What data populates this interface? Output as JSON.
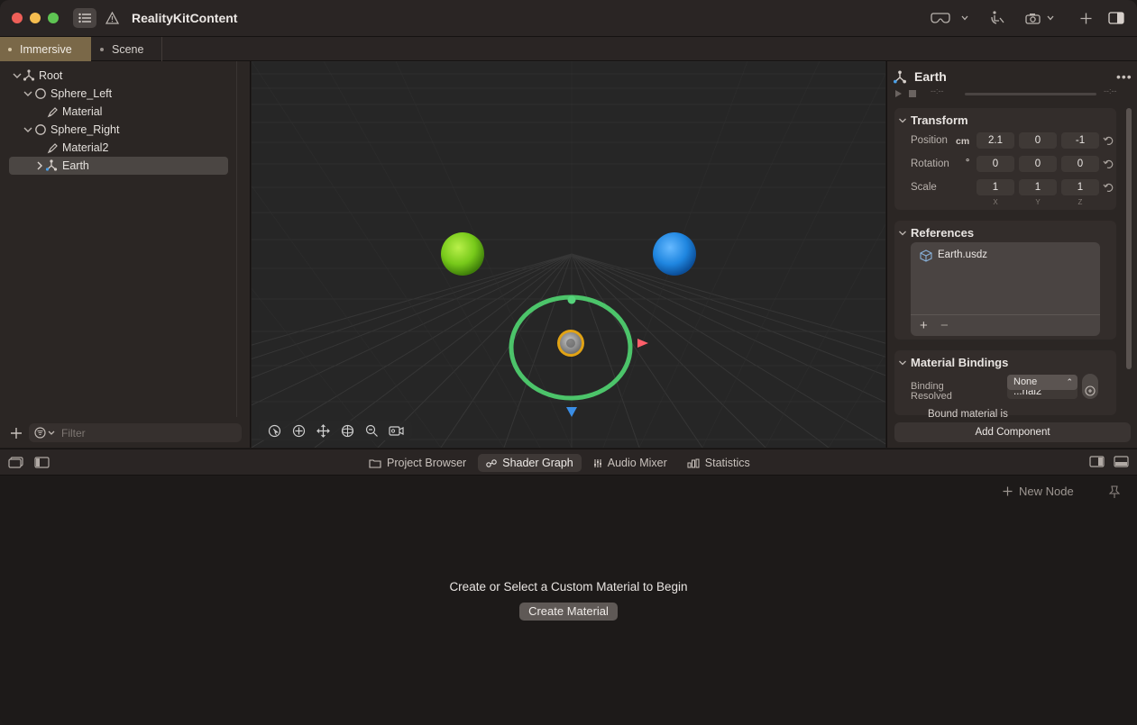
{
  "app": {
    "title": "RealityKitContent"
  },
  "tabs": [
    {
      "label": "Immersive",
      "active": true
    },
    {
      "label": "Scene",
      "active": false
    }
  ],
  "hierarchy": {
    "items": [
      {
        "label": "Root",
        "icon": "entity-icon",
        "expanded": true
      },
      {
        "label": "Sphere_Left",
        "icon": "sphere-icon",
        "expanded": true
      },
      {
        "label": "Material",
        "icon": "material-icon"
      },
      {
        "label": "Sphere_Right",
        "icon": "sphere-icon",
        "expanded": true
      },
      {
        "label": "Material2",
        "icon": "material-icon"
      },
      {
        "label": "Earth",
        "icon": "entity-icon",
        "expanded": false,
        "selected": true
      }
    ],
    "filter_placeholder": "Filter"
  },
  "inspector": {
    "title": "Earth",
    "timeline": {
      "start": "--:--",
      "end": "--:--"
    },
    "transform": {
      "header": "Transform",
      "position_label": "Position",
      "position_unit": "cm",
      "position": [
        "2.1",
        "0",
        "-1"
      ],
      "rotation_label": "Rotation",
      "rotation_unit": "°",
      "rotation": [
        "0",
        "0",
        "0"
      ],
      "scale_label": "Scale",
      "scale": [
        "1",
        "1",
        "1"
      ],
      "axes": [
        "X",
        "Y",
        "Z"
      ]
    },
    "references": {
      "header": "References",
      "file": "Earth.usdz",
      "add": "+",
      "remove": "−"
    },
    "material_bindings": {
      "header": "Material Bindings",
      "binding_label": "Binding",
      "resolved_label": "Resolved",
      "binding_value": "None",
      "resolved_value": "...rial2",
      "note": "Bound material is"
    },
    "add_component": "Add Component"
  },
  "bottom_tabs": [
    {
      "label": "Project Browser",
      "icon": "folder-icon",
      "active": false
    },
    {
      "label": "Shader Graph",
      "icon": "nodes-icon",
      "active": true
    },
    {
      "label": "Audio Mixer",
      "icon": "sliders-icon",
      "active": false
    },
    {
      "label": "Statistics",
      "icon": "bar-chart-icon",
      "active": false
    }
  ],
  "shader_graph": {
    "new_node": "New Node",
    "empty_message": "Create or Select a Custom Material to Begin",
    "create_button": "Create Material"
  },
  "colors": {
    "accent_tab": "#7a6848",
    "sphere_left": "#7fd11b",
    "sphere_right": "#1f86e0",
    "gizmo_ring": "#4cc46a"
  }
}
